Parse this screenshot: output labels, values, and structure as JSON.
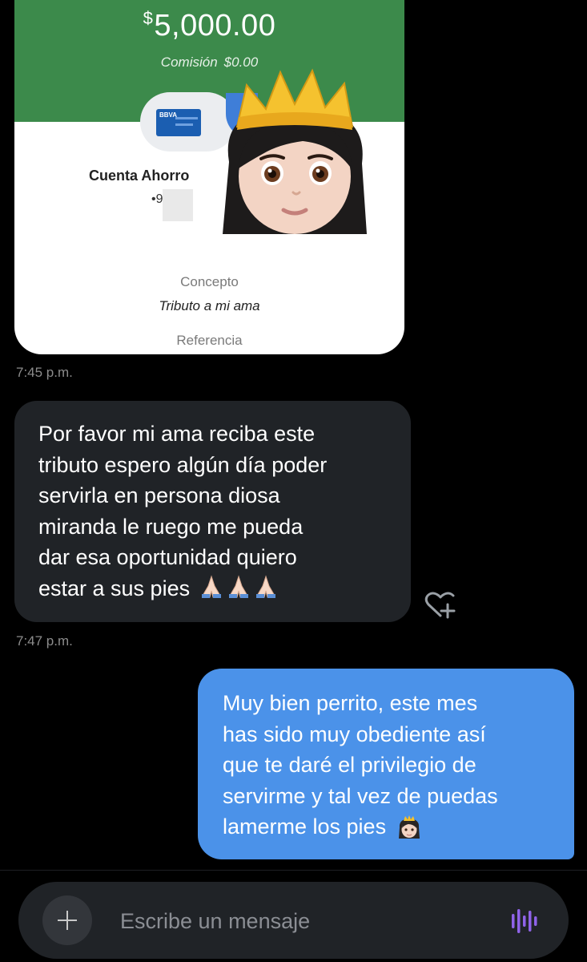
{
  "receipt": {
    "currency_symbol": "$",
    "amount": "5,000.00",
    "commission_label": "Comisión",
    "commission_value": "$0.00",
    "bank_logo_text": "BBVA",
    "account_name": "Cuenta Ahorro",
    "account_number_partial": "•9   1",
    "concept_label": "Concepto",
    "concept_value": "Tributo a mi ama",
    "reference_label": "Referencia"
  },
  "messages": [
    {
      "direction": "incoming",
      "text": "Por favor mi ama reciba este tributo espero algún día poder servirla en persona diosa miranda le ruego me pueda dar esa oportunidad quiero estar a sus pies",
      "lines": [
        "Por favor mi ama reciba este",
        "tributo espero algún día poder",
        "servirla en persona diosa",
        "miranda le ruego me pueda",
        "dar esa oportunidad quiero",
        "estar a sus pies"
      ],
      "emoji": "folded-hands x3"
    },
    {
      "direction": "outgoing",
      "text": "Muy bien perrito, este mes has sido muy obediente así que te daré el privilegio de servirme y tal vez de puedas lamerme los pies",
      "lines": [
        "Muy bien perrito, este mes",
        "has sido muy obediente así",
        "que te daré el privilegio de",
        "servirme y tal vez de puedas",
        "lamerme los pies"
      ],
      "emoji": "princess"
    }
  ],
  "timestamps": [
    "7:45 p.m.",
    "7:47 p.m."
  ],
  "composer": {
    "placeholder": "Escribe un mensaje",
    "add_icon": "plus-icon",
    "voice_icon": "voice-waveform-icon"
  },
  "colors": {
    "background": "#000000",
    "receipt_header": "#3c8a4b",
    "incoming_bubble": "#202327",
    "outgoing_bubble": "#4b92e9",
    "voice_accent": "#8f63e8"
  }
}
